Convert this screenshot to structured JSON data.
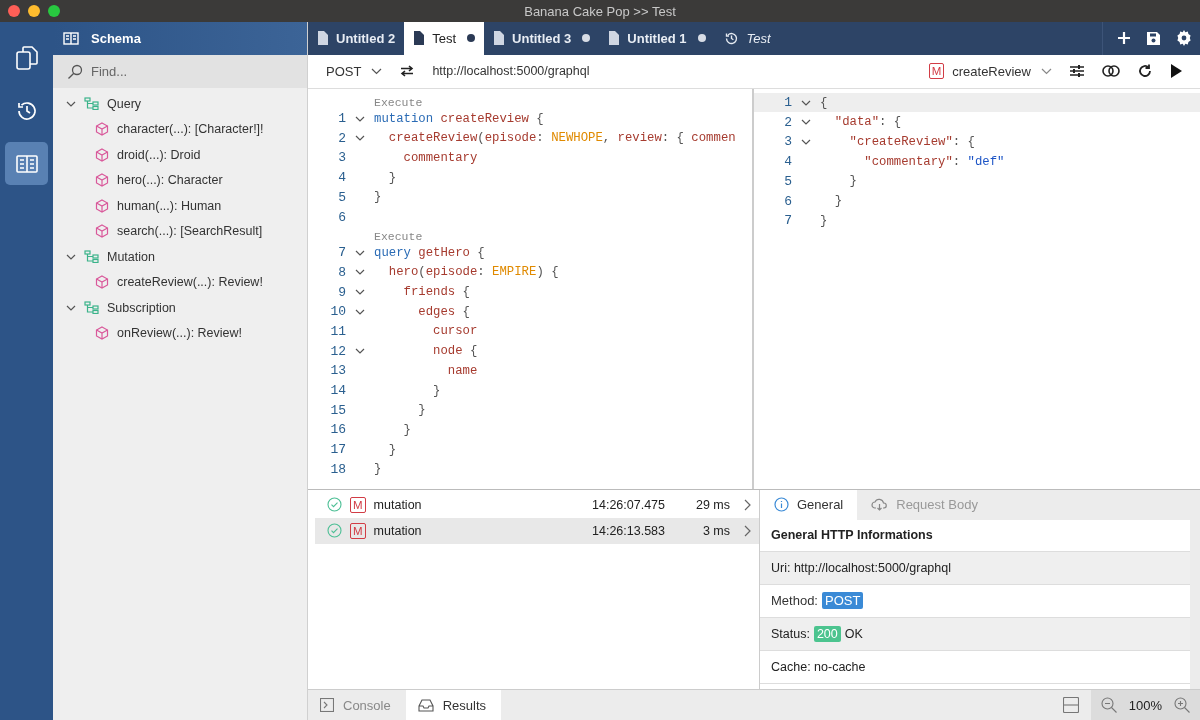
{
  "window": {
    "title": "Banana Cake Pop >> Test"
  },
  "rail": [
    {
      "selected": false
    },
    {
      "selected": false
    },
    {
      "selected": true
    }
  ],
  "sidebar": {
    "title": "Schema",
    "search": {
      "placeholder": "Find..."
    },
    "tree": [
      {
        "label": "Query",
        "expanded": true,
        "children": [
          {
            "label": "character(...): [Character!]!"
          },
          {
            "label": "droid(...): Droid"
          },
          {
            "label": "hero(...): Character"
          },
          {
            "label": "human(...): Human"
          },
          {
            "label": "search(...): [SearchResult]"
          }
        ]
      },
      {
        "label": "Mutation",
        "expanded": true,
        "children": [
          {
            "label": "createReview(...): Review!"
          }
        ]
      },
      {
        "label": "Subscription",
        "expanded": true,
        "children": [
          {
            "label": "onReview(...): Review!"
          }
        ]
      }
    ]
  },
  "tabs": [
    {
      "label": "Untitled 2",
      "kind": "document",
      "selected": false,
      "modified": false
    },
    {
      "label": "Test",
      "kind": "document",
      "selected": true,
      "modified": true
    },
    {
      "label": "Untitled 3",
      "kind": "document",
      "selected": false,
      "modified": true
    },
    {
      "label": "Untitled 1",
      "kind": "document",
      "selected": false,
      "modified": true
    },
    {
      "label": "Test",
      "kind": "history",
      "selected": false,
      "modified": false
    }
  ],
  "toolbar": {
    "method": "POST",
    "url": "http://localhost:5000/graphql",
    "operation": {
      "badge": "M",
      "name": "createReview"
    }
  },
  "query_editor": {
    "lines": [
      {
        "lens": "Execute",
        "number": "1",
        "fold": true,
        "tokens": [
          {
            "kind": "kw",
            "text": "mutation"
          },
          {
            "kind": "name",
            "text": " createReview"
          },
          {
            "kind": "punct",
            "text": " {"
          }
        ]
      },
      {
        "number": "2",
        "fold": true,
        "tokens": [
          {
            "kind": "name",
            "text": "  createReview"
          },
          {
            "kind": "punct",
            "text": "("
          },
          {
            "kind": "name",
            "text": "episode"
          },
          {
            "kind": "punct",
            "text": ": "
          },
          {
            "kind": "enum",
            "text": "NEWHOPE"
          },
          {
            "kind": "punct",
            "text": ", "
          },
          {
            "kind": "name",
            "text": "review"
          },
          {
            "kind": "punct",
            "text": ": { "
          },
          {
            "kind": "name",
            "text": "commen"
          }
        ]
      },
      {
        "number": "3",
        "fold": false,
        "tokens": [
          {
            "kind": "name",
            "text": "    commentary"
          }
        ]
      },
      {
        "number": "4",
        "fold": false,
        "tokens": [
          {
            "kind": "punct",
            "text": "  }"
          }
        ]
      },
      {
        "number": "5",
        "fold": false,
        "tokens": [
          {
            "kind": "punct",
            "text": "}"
          }
        ]
      },
      {
        "number": "6",
        "fold": false
      },
      {
        "lens": "Execute",
        "number": "7",
        "fold": true,
        "tokens": [
          {
            "kind": "kw",
            "text": "query"
          },
          {
            "kind": "name",
            "text": " getHero"
          },
          {
            "kind": "punct",
            "text": " {"
          }
        ]
      },
      {
        "number": "8",
        "fold": true,
        "tokens": [
          {
            "kind": "name",
            "text": "  hero"
          },
          {
            "kind": "punct",
            "text": "("
          },
          {
            "kind": "name",
            "text": "episode"
          },
          {
            "kind": "punct",
            "text": ": "
          },
          {
            "kind": "enum",
            "text": "EMPIRE"
          },
          {
            "kind": "punct",
            "text": ") {"
          }
        ]
      },
      {
        "number": "9",
        "fold": true,
        "tokens": [
          {
            "kind": "name",
            "text": "    friends"
          },
          {
            "kind": "punct",
            "text": " {"
          }
        ]
      },
      {
        "number": "10",
        "fold": true,
        "tokens": [
          {
            "kind": "name",
            "text": "      edges"
          },
          {
            "kind": "punct",
            "text": " {"
          }
        ]
      },
      {
        "number": "11",
        "fold": false,
        "tokens": [
          {
            "kind": "name",
            "text": "        cursor"
          }
        ]
      },
      {
        "number": "12",
        "fold": true,
        "tokens": [
          {
            "kind": "name",
            "text": "        node"
          },
          {
            "kind": "punct",
            "text": " {"
          }
        ]
      },
      {
        "number": "13",
        "fold": false,
        "tokens": [
          {
            "kind": "name",
            "text": "          name"
          }
        ]
      },
      {
        "number": "14",
        "fold": false,
        "tokens": [
          {
            "kind": "punct",
            "text": "        }"
          }
        ]
      },
      {
        "number": "15",
        "fold": false,
        "tokens": [
          {
            "kind": "punct",
            "text": "      }"
          }
        ]
      },
      {
        "number": "16",
        "fold": false,
        "tokens": [
          {
            "kind": "punct",
            "text": "    }"
          }
        ]
      },
      {
        "number": "17",
        "fold": false,
        "tokens": [
          {
            "kind": "punct",
            "text": "  }"
          }
        ]
      },
      {
        "number": "18",
        "fold": false,
        "tokens": [
          {
            "kind": "punct",
            "text": "}"
          }
        ]
      }
    ]
  },
  "response_editor": {
    "lines": [
      {
        "number": "1",
        "fold": true,
        "current": true,
        "tokens": [
          {
            "kind": "punct",
            "text": "{"
          }
        ]
      },
      {
        "number": "2",
        "fold": true,
        "current": false,
        "tokens": [
          {
            "kind": "key",
            "text": "  \"data\""
          },
          {
            "kind": "punct",
            "text": ": {"
          }
        ]
      },
      {
        "number": "3",
        "fold": true,
        "current": false,
        "tokens": [
          {
            "kind": "key",
            "text": "    \"createReview\""
          },
          {
            "kind": "punct",
            "text": ": {"
          }
        ]
      },
      {
        "number": "4",
        "fold": false,
        "current": false,
        "tokens": [
          {
            "kind": "key",
            "text": "      \"commentary\""
          },
          {
            "kind": "punct",
            "text": ": "
          },
          {
            "kind": "str",
            "text": "\"def\""
          }
        ]
      },
      {
        "number": "5",
        "fold": false,
        "current": false,
        "tokens": [
          {
            "kind": "punct",
            "text": "    }"
          }
        ]
      },
      {
        "number": "6",
        "fold": false,
        "current": false,
        "tokens": [
          {
            "kind": "punct",
            "text": "  }"
          }
        ]
      },
      {
        "number": "7",
        "fold": false,
        "current": false,
        "tokens": [
          {
            "kind": "punct",
            "text": "}"
          }
        ]
      }
    ]
  },
  "history": [
    {
      "badge": "M",
      "name": "mutation",
      "time": "14:26:07.475",
      "duration": "29 ms",
      "selected": false
    },
    {
      "badge": "M",
      "name": "mutation",
      "time": "14:26:13.583",
      "duration": "3 ms",
      "selected": true
    }
  ],
  "detail_tabs": [
    {
      "label": "General",
      "selected": true
    },
    {
      "label": "Request Body",
      "selected": false
    }
  ],
  "details": {
    "heading": "General HTTP Informations",
    "rows": [
      {
        "kind": "plain",
        "text": "Uri: http://localhost:5000/graphql"
      },
      {
        "kind": "method",
        "label": "Method:",
        "badge": "POST"
      },
      {
        "kind": "status",
        "label": "Status:",
        "badge": "200",
        "suffix": "OK"
      },
      {
        "kind": "plain",
        "text": "Cache: no-cache"
      }
    ]
  },
  "bottom_tabs": [
    {
      "label": "Console",
      "selected": false
    },
    {
      "label": "Results",
      "selected": true
    }
  ],
  "status_bar": {
    "zoom": "100%"
  }
}
